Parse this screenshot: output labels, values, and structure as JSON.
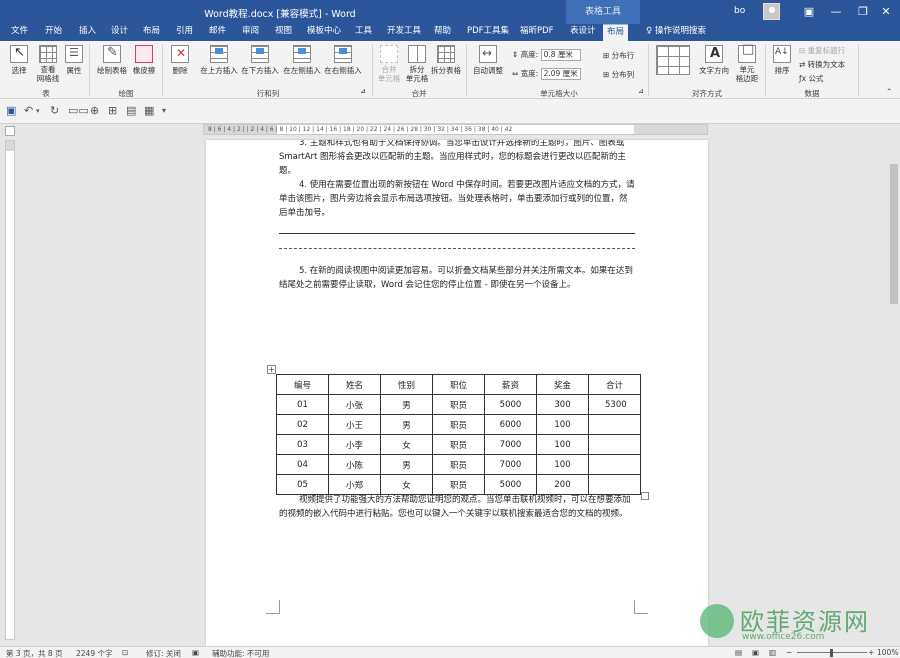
{
  "titlebar": {
    "title": "Word教程.docx [兼容模式] - Word",
    "context_group": "表格工具",
    "user": "bo",
    "minimize": "—",
    "restore": "❐",
    "close": "✕"
  },
  "tabs": [
    {
      "label": "文件"
    },
    {
      "label": "开始"
    },
    {
      "label": "插入"
    },
    {
      "label": "设计"
    },
    {
      "label": "布局"
    },
    {
      "label": "引用"
    },
    {
      "label": "邮件"
    },
    {
      "label": "审阅"
    },
    {
      "label": "视图"
    },
    {
      "label": "模板中心"
    },
    {
      "label": "工具"
    },
    {
      "label": "开发工具"
    },
    {
      "label": "帮助"
    },
    {
      "label": "PDF工具集"
    },
    {
      "label": "福昕PDF"
    },
    {
      "label": "表设计"
    },
    {
      "label": "布局"
    },
    {
      "label": "操作说明搜索"
    }
  ],
  "ribbon": {
    "select": "选择",
    "gridlines": "查看\n网格线",
    "properties": "属性",
    "group_table": "表",
    "draw_table": "绘制表格",
    "eraser": "橡皮擦",
    "group_draw": "绘图",
    "delete": "删除",
    "insert_above": "在上方插入",
    "insert_below": "在下方插入",
    "insert_left": "在左侧插入",
    "insert_right": "在右侧插入",
    "group_rows_cols": "行和列",
    "merge_cells": "合并\n单元格",
    "split_cells": "拆分\n单元格",
    "split_table": "拆分表格",
    "group_merge": "合并",
    "autofit": "自动调整",
    "height_label": "高度:",
    "height_value": "0.8 厘米",
    "width_label": "宽度:",
    "width_value": "2.09 厘米",
    "distribute_rows": "分布行",
    "distribute_cols": "分布列",
    "group_cell_size": "单元格大小",
    "text_direction": "文字方向",
    "cell_margins": "单元\n格边距",
    "group_alignment": "对齐方式",
    "sort": "排序",
    "repeat_header": "重复标题行",
    "convert_text": "转换为文本",
    "formula": "公式",
    "group_data": "数据"
  },
  "ruler": {
    "marks": "8 | 6 | 4 | 2 |   | 2 | 4 | 6 | 8 | 10 | 12 | 14 | 16 | 18 | 20 | 22 | 24 | 26 | 28 | 30 | 32 | 34 | 36 | 38 | 40 | 42"
  },
  "document": {
    "para1": "3. 主题和样式也有助于文档保持协调。当您单击设计并选择新的主题时，图片、图表或 SmartArt 图形将会更改以匹配新的主题。当应用样式时，您的标题会进行更改以匹配新的主题。",
    "para2": "4. 使用在需要位置出现的新按钮在 Word 中保存时间。若要更改图片适应文档的方式，请单击该图片，图片旁边将会显示布局选项按钮。当处理表格时，单击要添加行或列的位置，然后单击加号。",
    "para3": "5. 在新的阅读视图中阅读更加容易。可以折叠文档某些部分并关注所需文本。如果在达到结尾处之前需要停止读取，Word 会记住您的停止位置 - 即使在另一个设备上。",
    "para4": "视频提供了功能强大的方法帮助您证明您的观点。当您单击联机视频时，可以在想要添加的视频的嵌入代码中进行粘贴。您也可以键入一个关键字以联机搜索最适合您的文档的视频。",
    "table": {
      "headers": [
        "编号",
        "姓名",
        "性别",
        "职位",
        "薪资",
        "奖金",
        "合计"
      ],
      "rows": [
        [
          "01",
          "小张",
          "男",
          "职员",
          "5000",
          "300",
          "5300"
        ],
        [
          "02",
          "小王",
          "男",
          "职员",
          "6000",
          "100",
          ""
        ],
        [
          "03",
          "小李",
          "女",
          "职员",
          "7000",
          "100",
          ""
        ],
        [
          "04",
          "小陈",
          "男",
          "职员",
          "7000",
          "100",
          ""
        ],
        [
          "05",
          "小郑",
          "女",
          "职员",
          "5000",
          "200",
          ""
        ]
      ]
    }
  },
  "statusbar": {
    "page": "第 3 页，共 8 页",
    "words": "2249 个字",
    "track": "修订: 关闭",
    "accessibility": "辅助功能: 不可用",
    "zoom": "100%"
  },
  "watermark": {
    "name": "欧菲资源网",
    "url": "www.office26.com"
  }
}
